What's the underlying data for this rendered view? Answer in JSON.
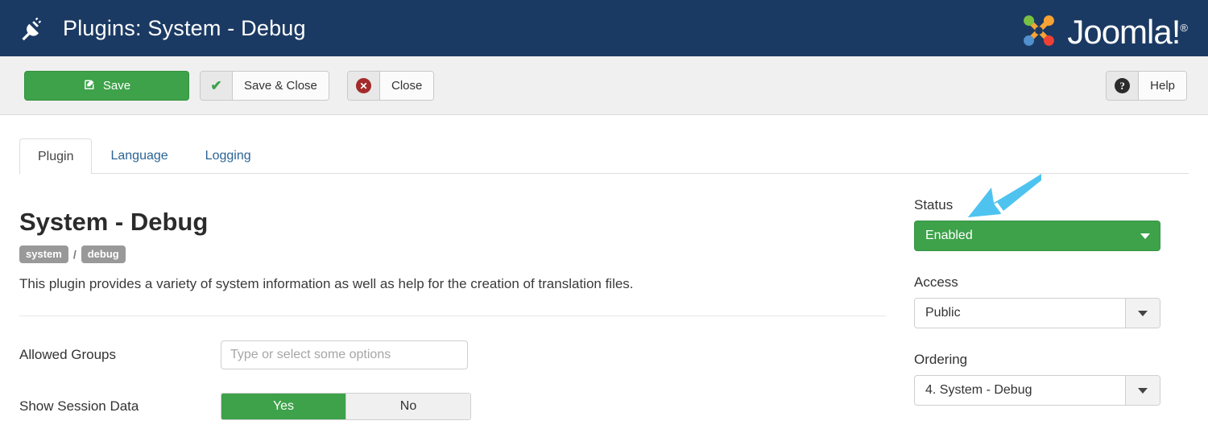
{
  "header": {
    "icon": "plug-icon",
    "title": "Plugins: System - Debug",
    "brand": "Joomla!",
    "brand_reg": "®",
    "bg_color": "#1b3a63"
  },
  "toolbar": {
    "save_label": "Save",
    "save_icon": "edit-square-icon",
    "save_close_label": "Save & Close",
    "save_close_icon": "check-icon",
    "close_label": "Close",
    "close_icon": "x-circle-icon",
    "help_label": "Help",
    "help_icon": "question-circle-icon",
    "accent_green": "#3da24a",
    "accent_red": "#a32b2b"
  },
  "tabs": [
    {
      "label": "Plugin",
      "active": true
    },
    {
      "label": "Language",
      "active": false
    },
    {
      "label": "Logging",
      "active": false
    }
  ],
  "main": {
    "page_title": "System - Debug",
    "badges": [
      "system",
      "debug"
    ],
    "badge_separator": "/",
    "description": "This plugin provides a variety of system information as well as help for the creation of translation files.",
    "fields": [
      {
        "label": "Allowed Groups",
        "type": "tag-input",
        "value": "",
        "placeholder": "Type or select some options"
      },
      {
        "label": "Show Session Data",
        "type": "toggle",
        "options": [
          "Yes",
          "No"
        ],
        "selected": "Yes"
      }
    ]
  },
  "sidebar": {
    "status": {
      "label": "Status",
      "value": "Enabled",
      "style": "green"
    },
    "access": {
      "label": "Access",
      "value": "Public"
    },
    "ordering": {
      "label": "Ordering",
      "value": "4. System - Debug"
    }
  },
  "annotation": {
    "arrow": "arrow-down-left-icon",
    "color": "#4ec3ef",
    "points_at": "status-select"
  }
}
